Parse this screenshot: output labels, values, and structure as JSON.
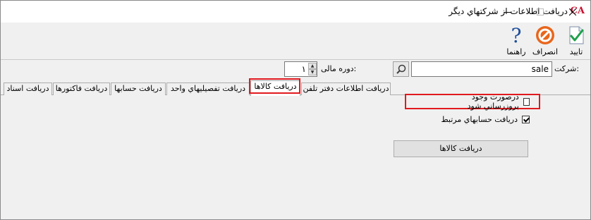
{
  "window": {
    "title": "دریافت اطلاعات از شرکتهاي دیگر",
    "logo": "CA"
  },
  "toolbar": {
    "ok_label": "تایید",
    "cancel_label": "انصراف",
    "help_label": "راهنما"
  },
  "company": {
    "label": "شرکت:",
    "value": "sale"
  },
  "period": {
    "label": "دوره مالی:",
    "value": "۱"
  },
  "tabs": [
    "دریافت اطلاعات دفتر تلفن",
    "دریافت کالاها",
    "دریافت تفصیلیهاي واحد",
    "دریافت حسابها",
    "دریافت فاکتورها",
    "دریافت اسناد"
  ],
  "options": {
    "update_existing_label": "درصورت وجود بروزرساني شود",
    "update_existing_checked": false,
    "related_accounts_label": "دریافت حسابهاي مرتبط",
    "related_accounts_checked": true
  },
  "action": {
    "receive_goods_label": "دریافت کالاها"
  },
  "colors": {
    "highlight": "#e1191e",
    "cancel_icon": "#e8661c",
    "help_icon": "#1f4e9a"
  }
}
